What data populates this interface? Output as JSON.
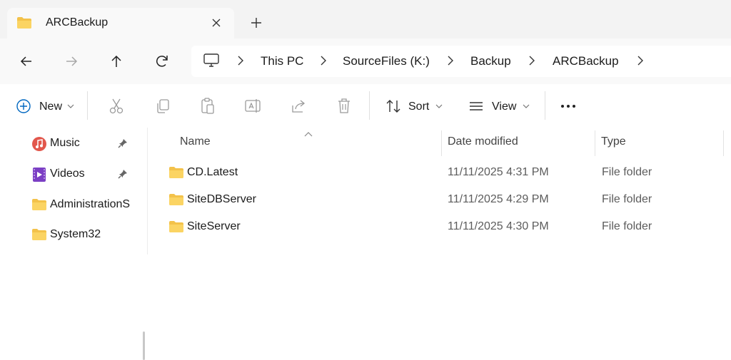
{
  "tab": {
    "title": "ARCBackup",
    "icon": "folder-icon"
  },
  "nav_buttons": [
    "back-icon",
    "forward-icon",
    "up-icon",
    "refresh-icon"
  ],
  "breadcrumb": {
    "items": [
      "This PC",
      "SourceFiles (K:)",
      "Backup",
      "ARCBackup"
    ],
    "root_icon": "monitor-icon"
  },
  "toolbar": {
    "new_label": "New",
    "sort_label": "Sort",
    "view_label": "View",
    "icons": [
      "cut-icon",
      "copy-icon",
      "paste-icon",
      "rename-icon",
      "share-icon",
      "delete-icon"
    ]
  },
  "sidebar": {
    "items": [
      {
        "label": "Music",
        "icon": "music-icon",
        "pinned": true
      },
      {
        "label": "Videos",
        "icon": "videos-icon",
        "pinned": true
      },
      {
        "label": "AdministrationS",
        "icon": "folder-icon",
        "pinned": false
      },
      {
        "label": "System32",
        "icon": "folder-icon",
        "pinned": false
      }
    ]
  },
  "table": {
    "columns": [
      "Name",
      "Date modified",
      "Type"
    ],
    "rows": [
      {
        "name": "CD.Latest",
        "date": "11/11/2025 4:31 PM",
        "type": "File folder"
      },
      {
        "name": "SiteDBServer",
        "date": "11/11/2025 4:29 PM",
        "type": "File folder"
      },
      {
        "name": "SiteServer",
        "date": "11/11/2025 4:30 PM",
        "type": "File folder"
      }
    ]
  },
  "colors": {
    "folder": "#f3c24a",
    "folder_dark": "#e2a92a",
    "accent": "#0067c0"
  }
}
